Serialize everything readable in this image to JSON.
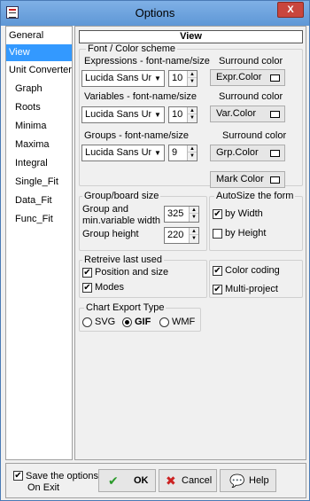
{
  "window": {
    "title": "Options",
    "close_glyph": "X"
  },
  "nav": {
    "items": [
      {
        "label": "General",
        "selected": false,
        "sub": false
      },
      {
        "label": "View",
        "selected": true,
        "sub": false
      },
      {
        "label": "Unit Converter",
        "selected": false,
        "sub": false
      },
      {
        "label": "Graph",
        "selected": false,
        "sub": true
      },
      {
        "label": "Roots",
        "selected": false,
        "sub": true
      },
      {
        "label": "Minima",
        "selected": false,
        "sub": true
      },
      {
        "label": "Maxima",
        "selected": false,
        "sub": true
      },
      {
        "label": "Integral",
        "selected": false,
        "sub": true
      },
      {
        "label": "Single_Fit",
        "selected": false,
        "sub": true
      },
      {
        "label": "Data_Fit",
        "selected": false,
        "sub": true
      },
      {
        "label": "Func_Fit",
        "selected": false,
        "sub": true
      }
    ]
  },
  "panel": {
    "header": "View",
    "font_color": {
      "title": "Font / Color scheme",
      "rows": [
        {
          "label": "Expressions - font-name/size",
          "surround": "Surround color",
          "font": "Lucida Sans Un",
          "size": "10",
          "button": "Expr.Color"
        },
        {
          "label": "Variables   - font-name/size",
          "surround": "Surround color",
          "font": "Lucida Sans Un",
          "size": "10",
          "button": "Var.Color"
        },
        {
          "label": "Groups        - font-name/size",
          "surround": "Surround color",
          "font": "Lucida Sans Un",
          "size": "9",
          "button": "Grp.Color"
        }
      ],
      "mark_color": "Mark Color"
    },
    "group_board": {
      "title": "Group/board size",
      "width_label": "Group and min.variable width",
      "width_value": "325",
      "height_label": "Group height",
      "height_value": "220"
    },
    "autosize": {
      "title": "AutoSize the form",
      "by_width": "by Width",
      "by_width_checked": true,
      "by_height": "by Height",
      "by_height_checked": false
    },
    "retreive": {
      "title": "Retreive last used",
      "position": "Position and size",
      "position_checked": true,
      "modes": "Modes",
      "modes_checked": true
    },
    "options": {
      "color_coding": "Color coding",
      "color_coding_checked": true,
      "multi_project": "Multi-project",
      "multi_project_checked": true
    },
    "export": {
      "title": "Chart Export Type",
      "svg": "SVG",
      "gif": "GIF",
      "wmf": "WMF",
      "selected": "GIF"
    }
  },
  "bottom": {
    "save_label_1": "Save the options",
    "save_label_2": "On Exit",
    "save_checked": true,
    "ok": "OK",
    "cancel": "Cancel",
    "help": "Help"
  },
  "colors": {
    "title_bar": "#6aa3e0",
    "selection": "#3399ff",
    "close": "#c9463d"
  }
}
